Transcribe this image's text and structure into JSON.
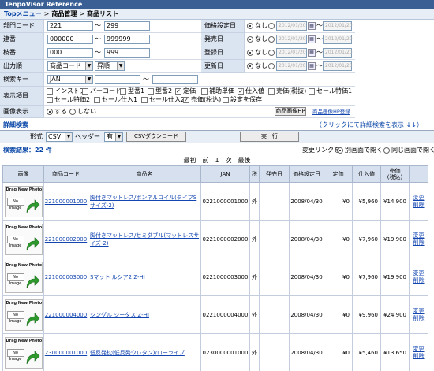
{
  "app": {
    "title": "TenpoVisor Reference"
  },
  "breadcrumb": {
    "top": "Topメニュー",
    "sep1": ">",
    "mid": "商品管理",
    "sep2": ">",
    "current": "商品リスト"
  },
  "search": {
    "dept": {
      "label": "部門コード",
      "from": "221",
      "to": "299",
      "tilde": "〜"
    },
    "serial": {
      "label": "連番",
      "from": "000000",
      "to": "999999",
      "tilde": "〜"
    },
    "branch": {
      "label": "枝番",
      "from": "000",
      "to": "999",
      "tilde": "〜"
    },
    "order": {
      "label": "出力順",
      "value": "商品コード",
      "dir": "昇順"
    },
    "key": {
      "label": "検索キー",
      "value": "JAN",
      "tilde": "〜"
    },
    "display": {
      "label": "表示項目",
      "row1": [
        {
          "text": "インストア",
          "checked": false
        },
        {
          "text": "バーコード",
          "checked": false
        },
        {
          "text": "型番1",
          "checked": false
        },
        {
          "text": "型番2",
          "checked": false
        },
        {
          "text": "定価",
          "checked": true
        },
        {
          "text": "補助単価",
          "checked": false
        },
        {
          "text": "仕入値",
          "checked": true
        },
        {
          "text": "売価(税抜)",
          "checked": false
        },
        {
          "text": "セール特価1",
          "checked": false
        }
      ],
      "row2": [
        {
          "text": "セール特価2",
          "checked": false
        },
        {
          "text": "セール仕入1",
          "checked": false
        },
        {
          "text": "セール仕入2",
          "checked": false
        },
        {
          "text": "売価(税込)",
          "checked": true
        },
        {
          "text": "設定を保存",
          "checked": false
        }
      ]
    },
    "image": {
      "label": "画像表示",
      "yes": "する",
      "no": "しない",
      "hp_button": "商品画像HP",
      "hp_link": "商品画像HP登録"
    },
    "price_date": {
      "label": "価格設定日",
      "none": "なし",
      "from": "2012/01/20",
      "to": "2012/01/20",
      "tilde": "〜"
    },
    "sale_date": {
      "label": "発売日",
      "none": "なし",
      "from": "2012/01/20",
      "to": "2012/01/20",
      "tilde": "〜"
    },
    "reg_date": {
      "label": "登録日",
      "none": "なし",
      "from": "2012/01/20",
      "to": "2012/01/20",
      "tilde": "〜"
    },
    "upd_date": {
      "label": "更新日",
      "none": "なし",
      "from": "2012/01/20",
      "to": "2012/01/20",
      "tilde": "〜"
    }
  },
  "detail": {
    "title": "詳細検索",
    "hint": "（クリックにて詳細検索を表示 ↓↓）"
  },
  "export": {
    "format_label": "形式",
    "format": "CSV",
    "header_label": "ヘッダー",
    "header": "有",
    "csv_button": "CSVダウンロード",
    "run_button": "実　行"
  },
  "results": {
    "count_label": "検索結果：",
    "count": "22 件",
    "link_label": "変更リンクを",
    "opt_new": "別画面で開く",
    "opt_same": "同じ画面で開く",
    "pager": "最初　前　1　次　最後"
  },
  "table": {
    "headers": [
      "画像",
      "商品コード",
      "商品名",
      "JAN",
      "税",
      "発売日",
      "価格設定日",
      "定価",
      "仕入値",
      "売価\n(税込)",
      ""
    ],
    "thumb": {
      "line1": "Drag New Photo",
      "line2": "No Image"
    },
    "rows": [
      {
        "code": "221000001000",
        "name": "脚付きマットレス/ボンネルコイル(タイプSサイズ-2)",
        "jan": "0221000001000",
        "tax": "外",
        "release": "",
        "price_date": "2008/04/30",
        "list": "¥0",
        "cost": "¥5,960",
        "sell": "¥14,900",
        "edit": "変更",
        "del": "削除"
      },
      {
        "code": "221000002000",
        "name": "脚付きマットレス/セミダブル(マットレスサイズ-2)",
        "jan": "0221000002000",
        "tax": "外",
        "release": "",
        "price_date": "2008/04/30",
        "list": "¥0",
        "cost": "¥7,960",
        "sell": "¥19,900",
        "edit": "変更",
        "del": "削除"
      },
      {
        "code": "221000003000",
        "name": "Sマット ルシア2 Z-HI",
        "jan": "0221000003000",
        "tax": "外",
        "release": "",
        "price_date": "2008/04/30",
        "list": "¥0",
        "cost": "¥7,960",
        "sell": "¥19,900",
        "edit": "変更",
        "del": "削除"
      },
      {
        "code": "221000004000",
        "name": "シングル シータス Z-HI",
        "jan": "0221000004000",
        "tax": "外",
        "release": "",
        "price_date": "2008/04/30",
        "list": "¥0",
        "cost": "¥9,960",
        "sell": "¥24,900",
        "edit": "変更",
        "del": "削除"
      },
      {
        "code": "230000001000",
        "name": "低反発枕(低反発ウレタン)/ローライプ",
        "jan": "0230000001000",
        "tax": "外",
        "release": "",
        "price_date": "2008/04/30",
        "list": "¥0",
        "cost": "¥5,460",
        "sell": "¥13,650",
        "edit": "変更",
        "del": "削除"
      }
    ]
  }
}
